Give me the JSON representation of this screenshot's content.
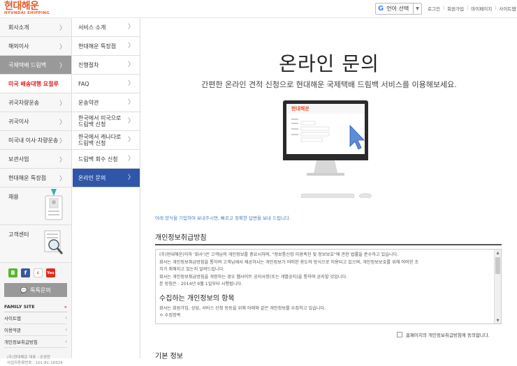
{
  "header": {
    "logo_ko": "현대해운",
    "logo_en": "HYUNDAI SHIPPING",
    "lang_label": "언어 선택",
    "lang_icon": "google-g-icon",
    "links": [
      "로그인",
      "회원가입",
      "마이페이지",
      "사이트맵"
    ]
  },
  "left_nav": {
    "items": [
      {
        "label": "회사소개"
      },
      {
        "label": "해외이사"
      },
      {
        "label": "국제택배 드림백"
      },
      {
        "label": "미국 배송대행 요절루"
      },
      {
        "label": "귀국차량운송"
      },
      {
        "label": "귀국이사"
      },
      {
        "label": "미국내 이사·차량운송"
      },
      {
        "label": "보관사업"
      },
      {
        "label": "현대해운 특장점"
      }
    ],
    "recruit": "채용",
    "support": "고객센터",
    "talk": "톡톡문의",
    "family_site": "FAMILY SITE",
    "footer_links": [
      "사이트맵",
      "이용약관",
      "개인정보취급방침"
    ],
    "copyright_1": "(주)현대해운 대표 : 조영현",
    "copyright_2": "사업자등록번호 : 101-81-16524"
  },
  "sub_nav": {
    "items": [
      {
        "label": "서비스 소개"
      },
      {
        "label": "현대해운 특장점"
      },
      {
        "label": "진행절차"
      },
      {
        "label": "FAQ"
      },
      {
        "label": "운송약관"
      },
      {
        "label": "한국에서 미국으로 드림백 신청"
      },
      {
        "label": "한국에서 캐나다로 드림백 신청"
      },
      {
        "label": "드림백 회수 신청"
      },
      {
        "label": "온라인 문의"
      }
    ]
  },
  "main": {
    "title": "온라인 문의",
    "subtitle": "간편한 온라인 견적 신청으로 현대해운 국제택배 드림백 서비스를 이용해보세요.",
    "notice": "아래 양식을 기입하여 보내주시면, 빠르고 정확한 답변을 보내 드립니다.",
    "section_privacy": "개인정보취급방침",
    "policy_lines": [
      "(주)현대해운(이하 '회사')은 고객님의 개인정보를 중요시하며, \"정보통신망 이용촉진 및 정보보호\"에 관한 법률을 준수하고 있습니다.",
      "회사는 개인정보취급방침을 통하여 고객님께서 제공하시는 개인정보가 어떠한 용도와 방식으로 이용되고 있으며, 개인정보보호를 위해 어떠한 조",
      "치가 취해지고 있는지 알려드립니다.",
      "회사는 개인정보취급방침을 개정하는 경우 웹사이트 공지사항(또는 개별공지)을 통하여 공지할 것입니다.",
      "본 방침은 : 2014년 9월 1일부터 시행됩니다."
    ],
    "policy_heading": "수집하는 개인정보의 항목",
    "policy_lines_2": [
      "회사는 회원가입, 상담, 서비스 신청 등등을 위해 아래와 같은 개인정보를 수집하고 있습니다.",
      "ㅇ 수집항목"
    ],
    "agree_label": "홈페이지의 개인정보취급방침에 동의합니다.",
    "section_basic": "기본 정보"
  },
  "colors": {
    "brand_orange": "#e85a2c",
    "active_blue": "#2f56a8",
    "highlight_red": "#e4201f",
    "active_gray": "#999999"
  }
}
